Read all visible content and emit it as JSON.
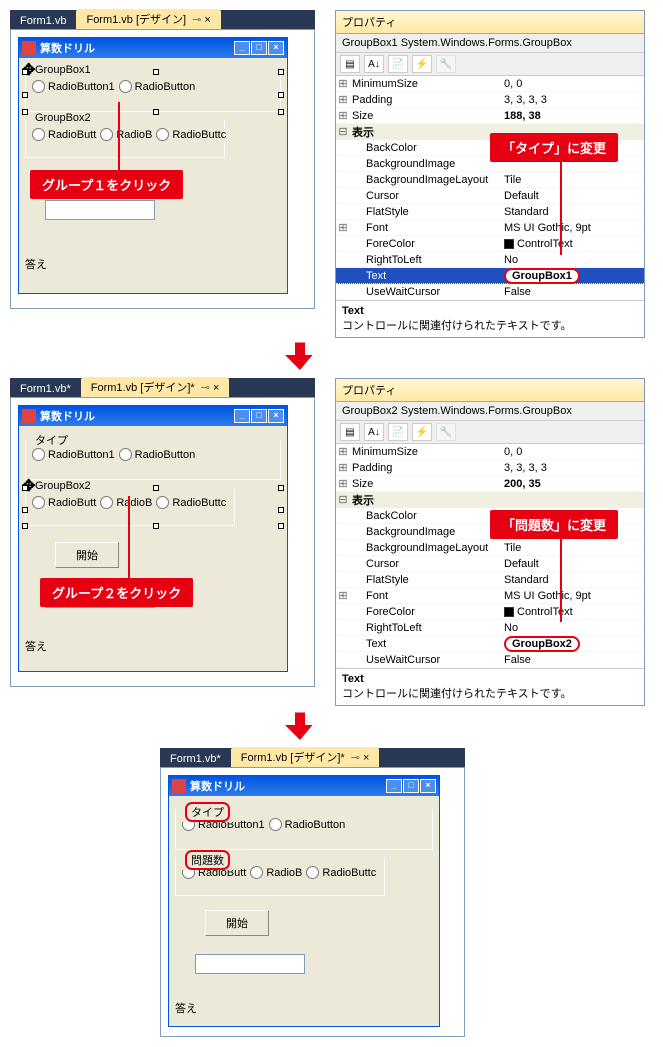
{
  "tabs": {
    "code": "Form1.vb",
    "design": "Form1.vb [デザイン]",
    "design_mod": "Form1.vb [デザイン]*",
    "code_mod": "Form1.vb*"
  },
  "form": {
    "title": "算数ドリル",
    "answer": "答え",
    "start": "開始"
  },
  "gb1": {
    "label": "GroupBox1",
    "label_after": "タイプ",
    "r1": "RadioButton1",
    "r2": "RadioButton"
  },
  "gb2": {
    "label": "GroupBox2",
    "label_after": "問題数",
    "r1": "RadioButt",
    "r2": "RadioB",
    "r3": "RadioButtc"
  },
  "callout": {
    "c1": "グループ１をクリック",
    "c2": "グループ２をクリック",
    "t1": "「タイプ」に変更",
    "t2": "「問題数」に変更"
  },
  "props": {
    "title": "プロパティ",
    "obj1": "GroupBox1  System.Windows.Forms.GroupBox",
    "obj2": "GroupBox2  System.Windows.Forms.GroupBox",
    "foot_label": "Text",
    "foot_desc": "コントロールに関連付けられたテキストです。"
  },
  "rows1": [
    {
      "exp": "⊞",
      "k": "MinimumSize",
      "v": "0, 0"
    },
    {
      "exp": "⊞",
      "k": "Padding",
      "v": "3, 3, 3, 3"
    },
    {
      "exp": "⊞",
      "k": "Size",
      "v": "188, 38",
      "bold": true
    },
    {
      "exp": "⊟",
      "k": "表示",
      "v": "",
      "cat": true
    },
    {
      "exp": "",
      "k": "BackColor",
      "v": "",
      "sub": true
    },
    {
      "exp": "",
      "k": "BackgroundImage",
      "v": "",
      "sub": true
    },
    {
      "exp": "",
      "k": "BackgroundImageLayout",
      "v": "Tile",
      "sub": true
    },
    {
      "exp": "",
      "k": "Cursor",
      "v": "Default",
      "sub": true
    },
    {
      "exp": "",
      "k": "FlatStyle",
      "v": "Standard",
      "sub": true
    },
    {
      "exp": "⊞",
      "k": "Font",
      "v": "MS UI Gothic, 9pt",
      "sub": true
    },
    {
      "exp": "",
      "k": "ForeColor",
      "v": "ControlText",
      "sub": true,
      "sw": "#000"
    },
    {
      "exp": "",
      "k": "RightToLeft",
      "v": "No",
      "sub": true
    },
    {
      "exp": "",
      "k": "Text",
      "v": "GroupBox1",
      "sub": true,
      "sel": true,
      "circle": true
    },
    {
      "exp": "",
      "k": "UseWaitCursor",
      "v": "False",
      "sub": true
    }
  ],
  "rows2": [
    {
      "exp": "⊞",
      "k": "MinimumSize",
      "v": "0, 0"
    },
    {
      "exp": "⊞",
      "k": "Padding",
      "v": "3, 3, 3, 3"
    },
    {
      "exp": "⊞",
      "k": "Size",
      "v": "200, 35",
      "bold": true
    },
    {
      "exp": "⊟",
      "k": "表示",
      "v": "",
      "cat": true
    },
    {
      "exp": "",
      "k": "BackColor",
      "v": "",
      "sub": true
    },
    {
      "exp": "",
      "k": "BackgroundImage",
      "v": "",
      "sub": true
    },
    {
      "exp": "",
      "k": "BackgroundImageLayout",
      "v": "Tile",
      "sub": true
    },
    {
      "exp": "",
      "k": "Cursor",
      "v": "Default",
      "sub": true
    },
    {
      "exp": "",
      "k": "FlatStyle",
      "v": "Standard",
      "sub": true
    },
    {
      "exp": "⊞",
      "k": "Font",
      "v": "MS UI Gothic, 9pt",
      "sub": true
    },
    {
      "exp": "",
      "k": "ForeColor",
      "v": "ControlText",
      "sub": true,
      "sw": "#000"
    },
    {
      "exp": "",
      "k": "RightToLeft",
      "v": "No",
      "sub": true
    },
    {
      "exp": "",
      "k": "Text",
      "v": "GroupBox2",
      "sub": true,
      "circle": true,
      "bold": true
    },
    {
      "exp": "",
      "k": "UseWaitCursor",
      "v": "False",
      "sub": true
    }
  ]
}
